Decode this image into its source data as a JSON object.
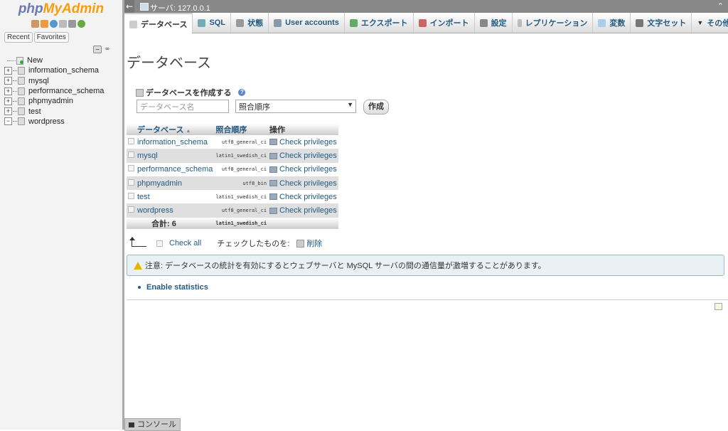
{
  "nav": {
    "logo_a": "php",
    "logo_b": "MyAdmin",
    "tabs": [
      "Recent",
      "Favorites"
    ],
    "tree": [
      "New",
      "information_schema",
      "mysql",
      "performance_schema",
      "phpmyadmin",
      "test",
      "wordpress"
    ]
  },
  "topbar": {
    "back": "←",
    "server": "サーバ: 127.0.0.1",
    "max": "⌃"
  },
  "menu": [
    "データベース",
    "SQL",
    "状態",
    "User accounts",
    "エクスポート",
    "インポート",
    "設定",
    "レプリケーション",
    "変数",
    "文字セット",
    "その他"
  ],
  "main": {
    "title": "データベース",
    "create_label": "データベースを作成する",
    "db_name_placeholder": "データベース名",
    "collation_value": "照合順序",
    "create_button": "作成",
    "table": {
      "headers": [
        "データベース",
        "照合順序",
        "操作"
      ],
      "rows": [
        {
          "name": "information_schema",
          "collation": "utf8_general_ci",
          "action": "Check privileges"
        },
        {
          "name": "mysql",
          "collation": "latin1_swedish_ci",
          "action": "Check privileges"
        },
        {
          "name": "performance_schema",
          "collation": "utf8_general_ci",
          "action": "Check privileges"
        },
        {
          "name": "phpmyadmin",
          "collation": "utf8_bin",
          "action": "Check privileges"
        },
        {
          "name": "test",
          "collation": "latin1_swedish_ci",
          "action": "Check privileges"
        },
        {
          "name": "wordpress",
          "collation": "utf8_general_ci",
          "action": "Check privileges"
        }
      ],
      "total_label": "合計: 6",
      "total_collation": "latin1_swedish_ci"
    },
    "check_all": "Check all",
    "with_selected": "チェックしたものを:",
    "delete": "削除",
    "notice": "注意: データベースの統計を有効にするとウェブサーバと MySQL サーバの間の通信量が激増することがあります。",
    "enable_statistics": "Enable statistics"
  },
  "console": "コンソール",
  "colors": {
    "link": "#235a81",
    "logo_php": "#6c78af",
    "logo_myadmin": "#f89c0e"
  }
}
